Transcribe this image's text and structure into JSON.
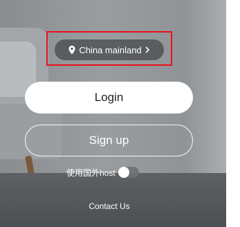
{
  "region": {
    "label": "China mainland",
    "pin_icon": "location-pin-icon",
    "chevron_icon": "chevron-right-icon",
    "highlight_color": "#e8101a"
  },
  "auth": {
    "login_label": "Login",
    "signup_label": "Sign up"
  },
  "host_option": {
    "label": "使用国外host",
    "enabled": false
  },
  "footer": {
    "contact_label": "Contact Us"
  },
  "colors": {
    "button_fill": "#ffffff",
    "pill_bg": "#46484c"
  }
}
